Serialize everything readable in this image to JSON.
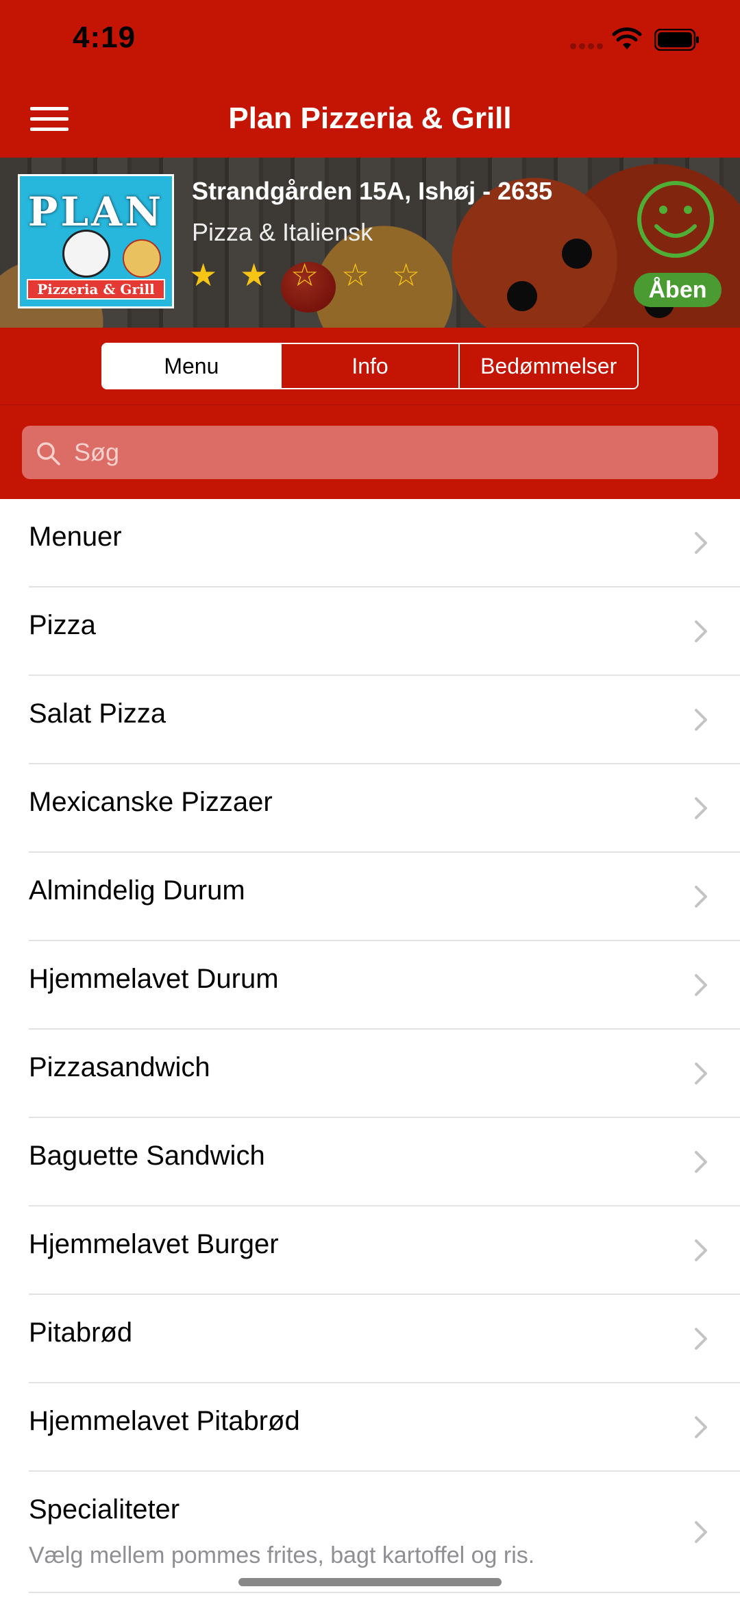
{
  "status_bar": {
    "time": "4:19"
  },
  "nav": {
    "title": "Plan Pizzeria & Grill"
  },
  "restaurant": {
    "logo_text": "PLAN",
    "logo_subtitle": "Pizzeria & Grill",
    "address": "Strandgården 15A, Ishøj - 2635",
    "cuisine": "Pizza & Italiensk",
    "rating": {
      "value": 2,
      "max": 5
    },
    "status": "Åben"
  },
  "tabs": [
    {
      "label": "Menu",
      "active": true
    },
    {
      "label": "Info",
      "active": false
    },
    {
      "label": "Bedømmelser",
      "active": false
    }
  ],
  "search": {
    "placeholder": "Søg",
    "value": ""
  },
  "menu_items": [
    {
      "label": "Menuer"
    },
    {
      "label": "Pizza"
    },
    {
      "label": "Salat Pizza"
    },
    {
      "label": "Mexicanske Pizzaer"
    },
    {
      "label": "Almindelig Durum"
    },
    {
      "label": "Hjemmelavet Durum"
    },
    {
      "label": "Pizzasandwich"
    },
    {
      "label": "Baguette Sandwich"
    },
    {
      "label": "Hjemmelavet Burger"
    },
    {
      "label": "Pitabrød"
    },
    {
      "label": "Hjemmelavet Pitabrød"
    },
    {
      "label": "Specialiteter",
      "subtitle": "Vælg mellem pommes frites, bagt kartoffel og ris."
    }
  ],
  "colors": {
    "brand_red": "#c41404",
    "open_green": "#4a9c32",
    "star_yellow": "#f6c516",
    "logo_blue": "#27b6dc"
  },
  "icons": {
    "menu": "hamburger-icon",
    "signal": "cellular-signal-icon",
    "wifi": "wifi-icon",
    "battery": "battery-icon",
    "status": "smiley-icon",
    "search": "search-icon",
    "disclosure": "chevron-right-icon"
  }
}
